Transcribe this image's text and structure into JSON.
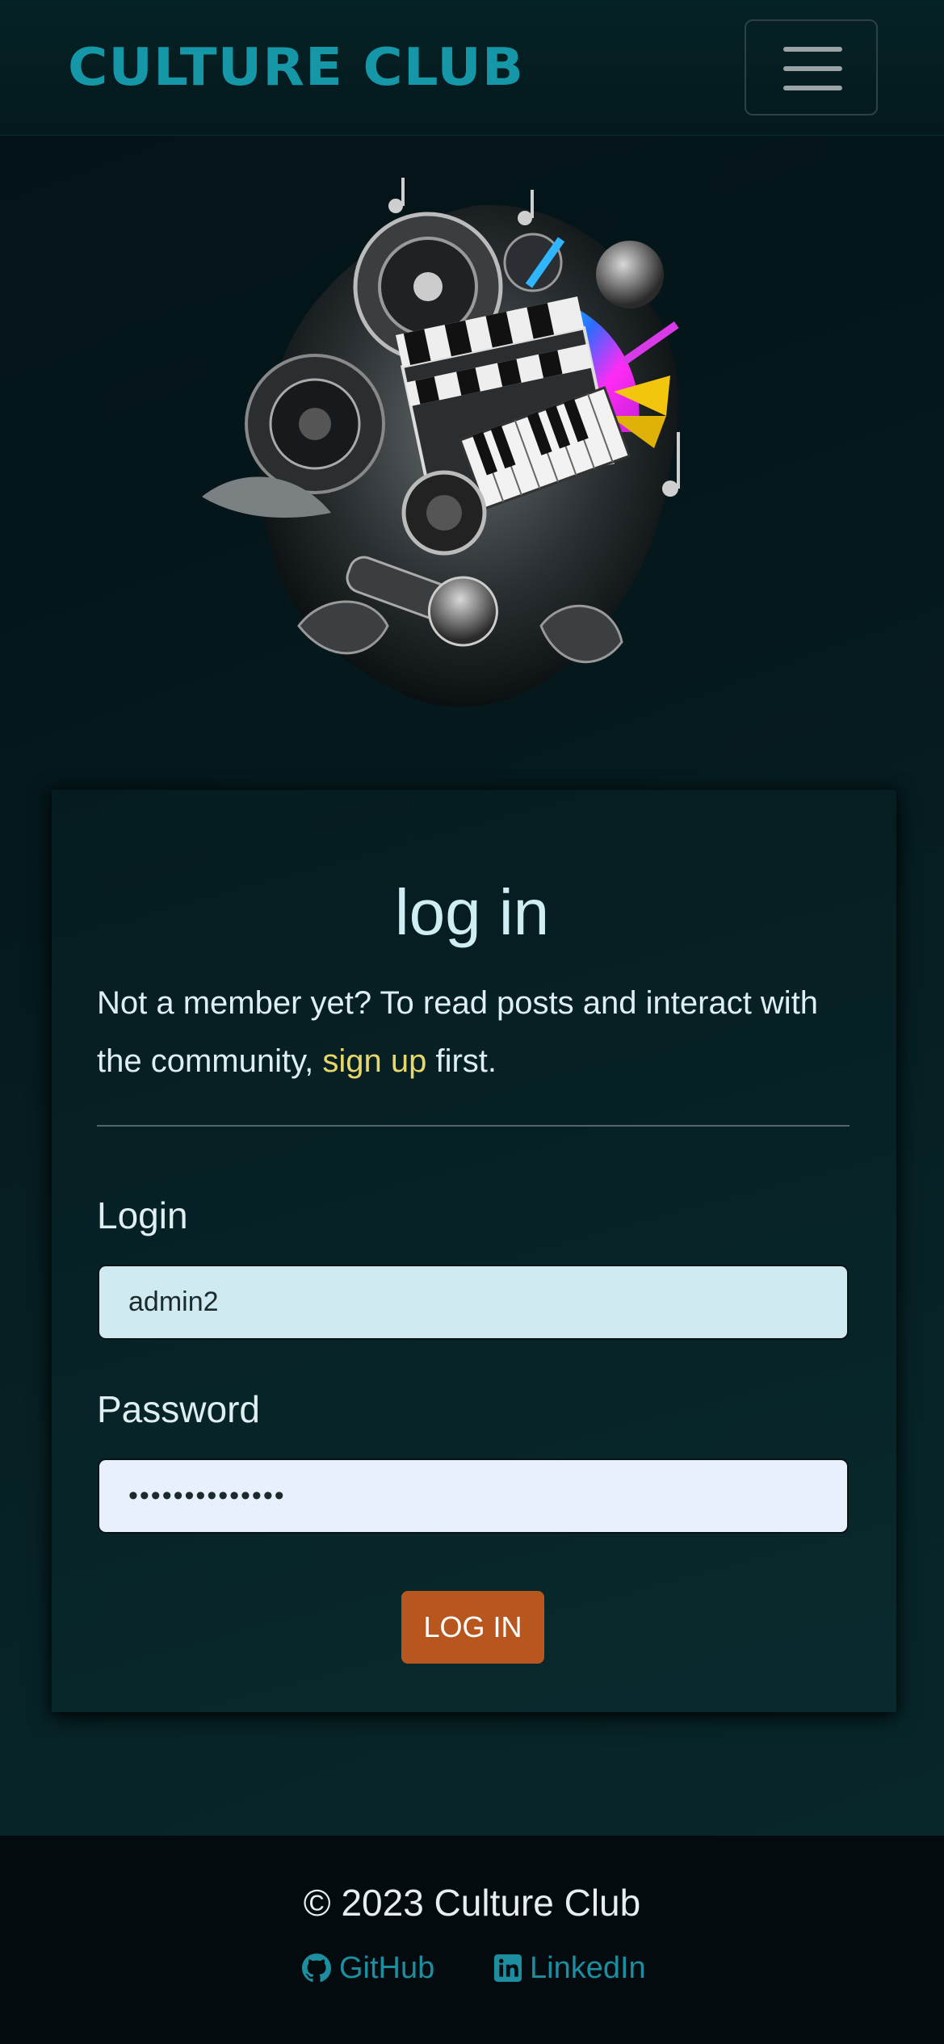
{
  "navbar": {
    "brand": "CULTURE CLUB",
    "menu_icon": "hamburger-menu-icon"
  },
  "hero": {
    "image_icon": "culture-collage-image"
  },
  "login_card": {
    "title": "log in",
    "intro_prefix": "Not a member yet? To read posts and interact with the community,",
    "signup_link": "sign up",
    "intro_suffix": "first.",
    "login_label": "Login",
    "login_value": "admin2",
    "password_label": "Password",
    "password_value": "••••••••••••••",
    "submit_label": "LOG IN"
  },
  "footer": {
    "copyright": "© 2023 Culture Club",
    "github_label": "GitHub",
    "github_icon": "github-icon",
    "linkedin_label": "LinkedIn",
    "linkedin_icon": "linkedin-icon"
  },
  "colors": {
    "brand": "#1597a8",
    "accent_link": "#e8d76a",
    "button": "#b7571f",
    "footer_link": "#1d8da0"
  }
}
